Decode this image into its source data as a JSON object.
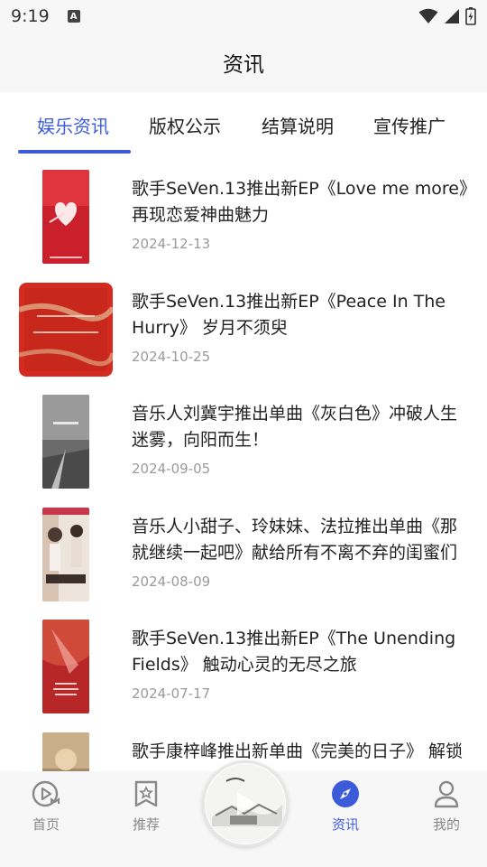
{
  "status_bar": {
    "time": "9:19",
    "notification": "A"
  },
  "header": {
    "title": "资讯"
  },
  "tabs": [
    {
      "label": "娱乐资讯",
      "active": true
    },
    {
      "label": "版权公示",
      "active": false
    },
    {
      "label": "结算说明",
      "active": false
    },
    {
      "label": "宣传推广",
      "active": false
    }
  ],
  "news": [
    {
      "title": "歌手SeVen.13推出新EP《Love me more》再现恋爱神曲魅力",
      "date": "2024-12-13"
    },
    {
      "title": "歌手SeVen.13推出新EP《Peace In The Hurry》 岁月不须臾",
      "date": "2024-10-25"
    },
    {
      "title": "音乐人刘冀宇推出单曲《灰白色》冲破人生迷雾，向阳而生！",
      "date": "2024-09-05"
    },
    {
      "title": "音乐人小甜子、玲妹妹、法拉推出单曲《那就继续一起吧》献给所有不离不弃的闺蜜们",
      "date": "2024-08-09"
    },
    {
      "title": "歌手SeVen.13推出新EP《The Unending Fields》 触动心灵的无尽之旅",
      "date": "2024-07-17"
    },
    {
      "title": "歌手康梓峰推出新单曲《完美的日子》 解锁",
      "date": ""
    }
  ],
  "bottom_nav": [
    {
      "label": "首页",
      "icon": "play-tv-icon",
      "active": false
    },
    {
      "label": "推荐",
      "icon": "bookmark-star-icon",
      "active": false
    },
    {
      "label": "资讯",
      "icon": "compass-icon",
      "active": true
    },
    {
      "label": "我的",
      "icon": "user-icon",
      "active": false
    }
  ],
  "center_button": {
    "icon": "play-icon"
  },
  "colors": {
    "accent": "#3b5bdb",
    "muted": "#888888"
  }
}
